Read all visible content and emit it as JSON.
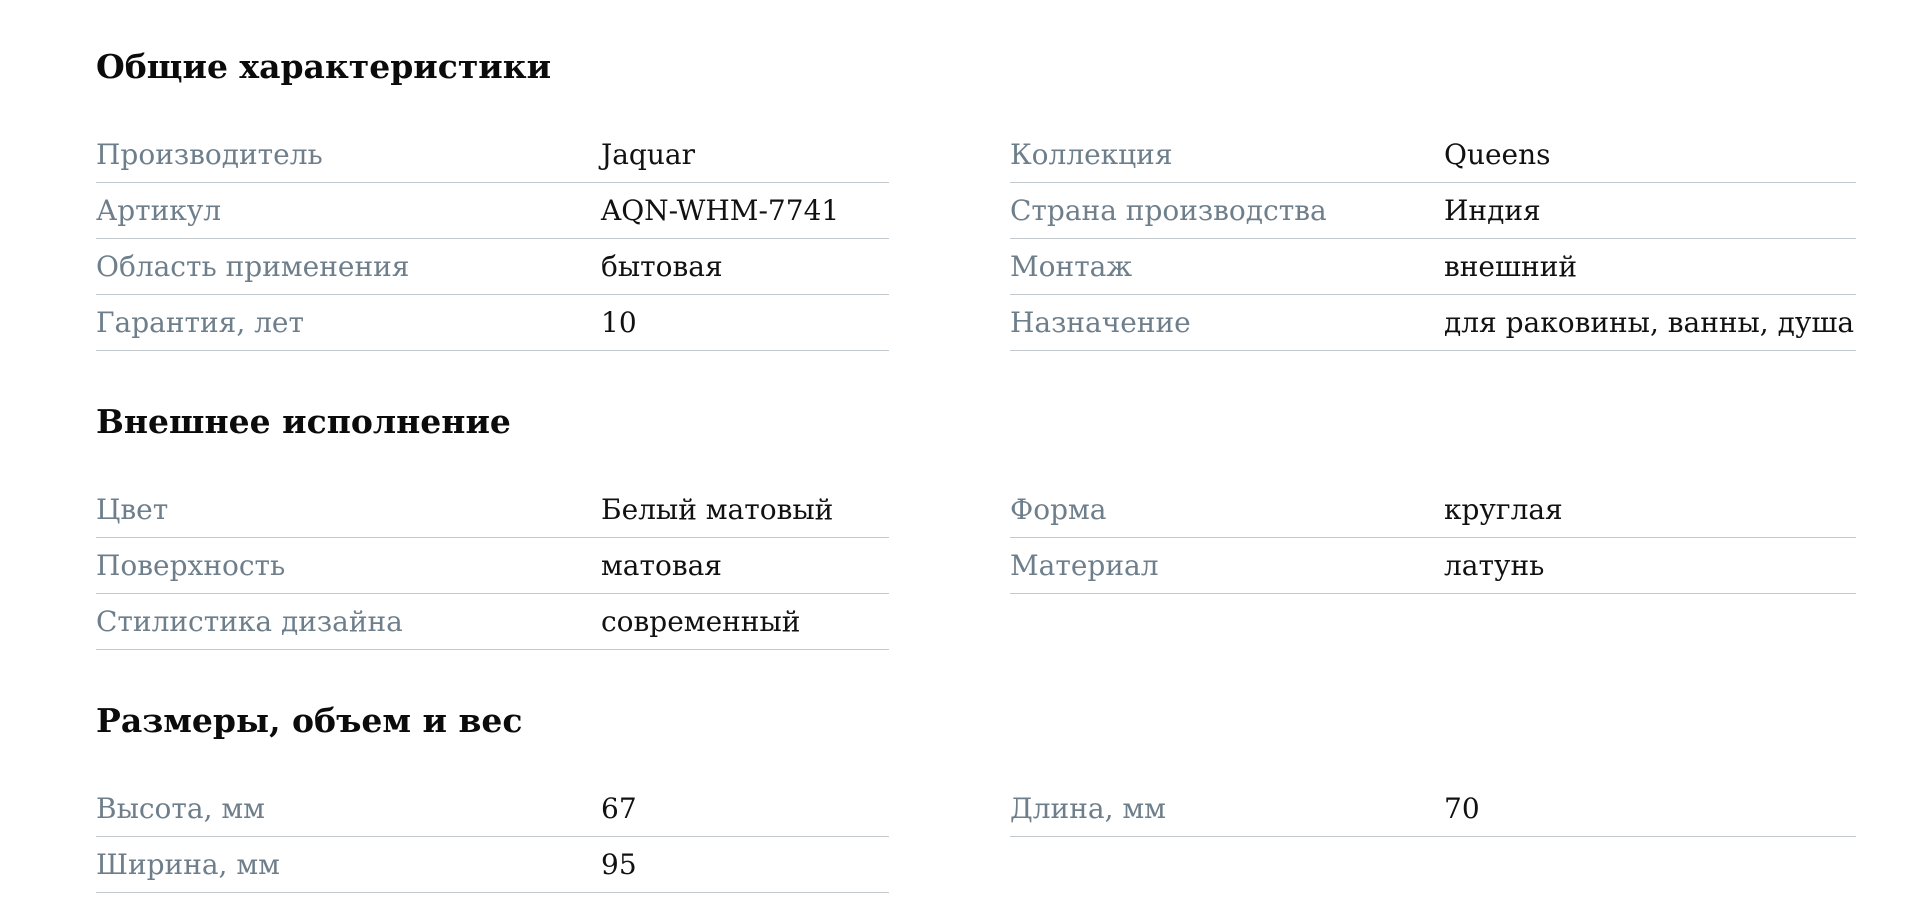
{
  "sections": [
    {
      "title": "Общие характеристики",
      "left": [
        {
          "label": "Производитель",
          "value": "Jaquar"
        },
        {
          "label": "Артикул",
          "value": "AQN-WHM-7741"
        },
        {
          "label": "Область применения",
          "value": "бытовая"
        },
        {
          "label": "Гарантия, лет",
          "value": "10"
        }
      ],
      "right": [
        {
          "label": "Коллекция",
          "value": "Queens"
        },
        {
          "label": "Страна производства",
          "value": "Индия"
        },
        {
          "label": "Монтаж",
          "value": "внешний"
        },
        {
          "label": "Назначение",
          "value": "для раковины, ванны, душа"
        }
      ]
    },
    {
      "title": "Внешнее исполнение",
      "left": [
        {
          "label": "Цвет",
          "value": "Белый матовый"
        },
        {
          "label": "Поверхность",
          "value": "матовая"
        },
        {
          "label": "Стилистика дизайна",
          "value": "современный"
        }
      ],
      "right": [
        {
          "label": "Форма",
          "value": "круглая"
        },
        {
          "label": "Материал",
          "value": "латунь"
        }
      ]
    },
    {
      "title": "Размеры, объем и вес",
      "left": [
        {
          "label": "Высота, мм",
          "value": "67"
        },
        {
          "label": "Ширина, мм",
          "value": "95"
        }
      ],
      "right": [
        {
          "label": "Длина, мм",
          "value": "70"
        }
      ]
    }
  ],
  "colors": {
    "label": "#6e7f8b",
    "value": "#111111",
    "divider": "#c3c8cc"
  }
}
